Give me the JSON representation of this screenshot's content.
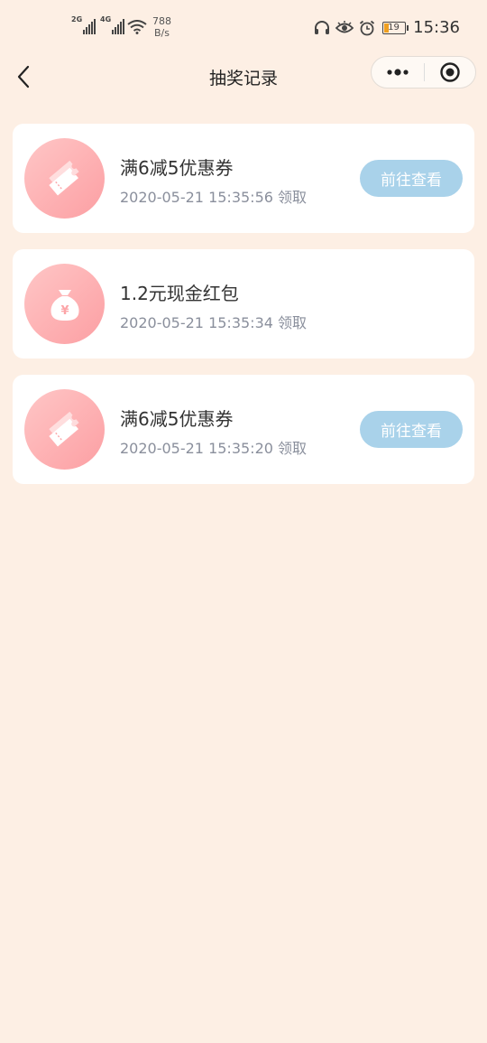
{
  "status_bar": {
    "sim1": "2G",
    "sim2": "4G",
    "net_speed_value": "788",
    "net_speed_unit": "B/s",
    "battery": "19",
    "time": "15:36"
  },
  "nav": {
    "title": "抽奖记录"
  },
  "records": [
    {
      "title": "满6减5优惠券",
      "time": "2020-05-21 15:35:56 领取",
      "icon": "coupon-icon",
      "action": "前往查看"
    },
    {
      "title": "1.2元现金红包",
      "time": "2020-05-21 15:35:34 领取",
      "icon": "money-bag-icon",
      "action": ""
    },
    {
      "title": "满6减5优惠券",
      "time": "2020-05-21 15:35:20 领取",
      "icon": "coupon-icon",
      "action": "前往查看"
    }
  ],
  "colors": {
    "background": "#fdefe4",
    "card": "#ffffff",
    "button": "#a9d2ea",
    "icon_circle_start": "#ffc6c6",
    "icon_circle_end": "#fc9fa3"
  }
}
